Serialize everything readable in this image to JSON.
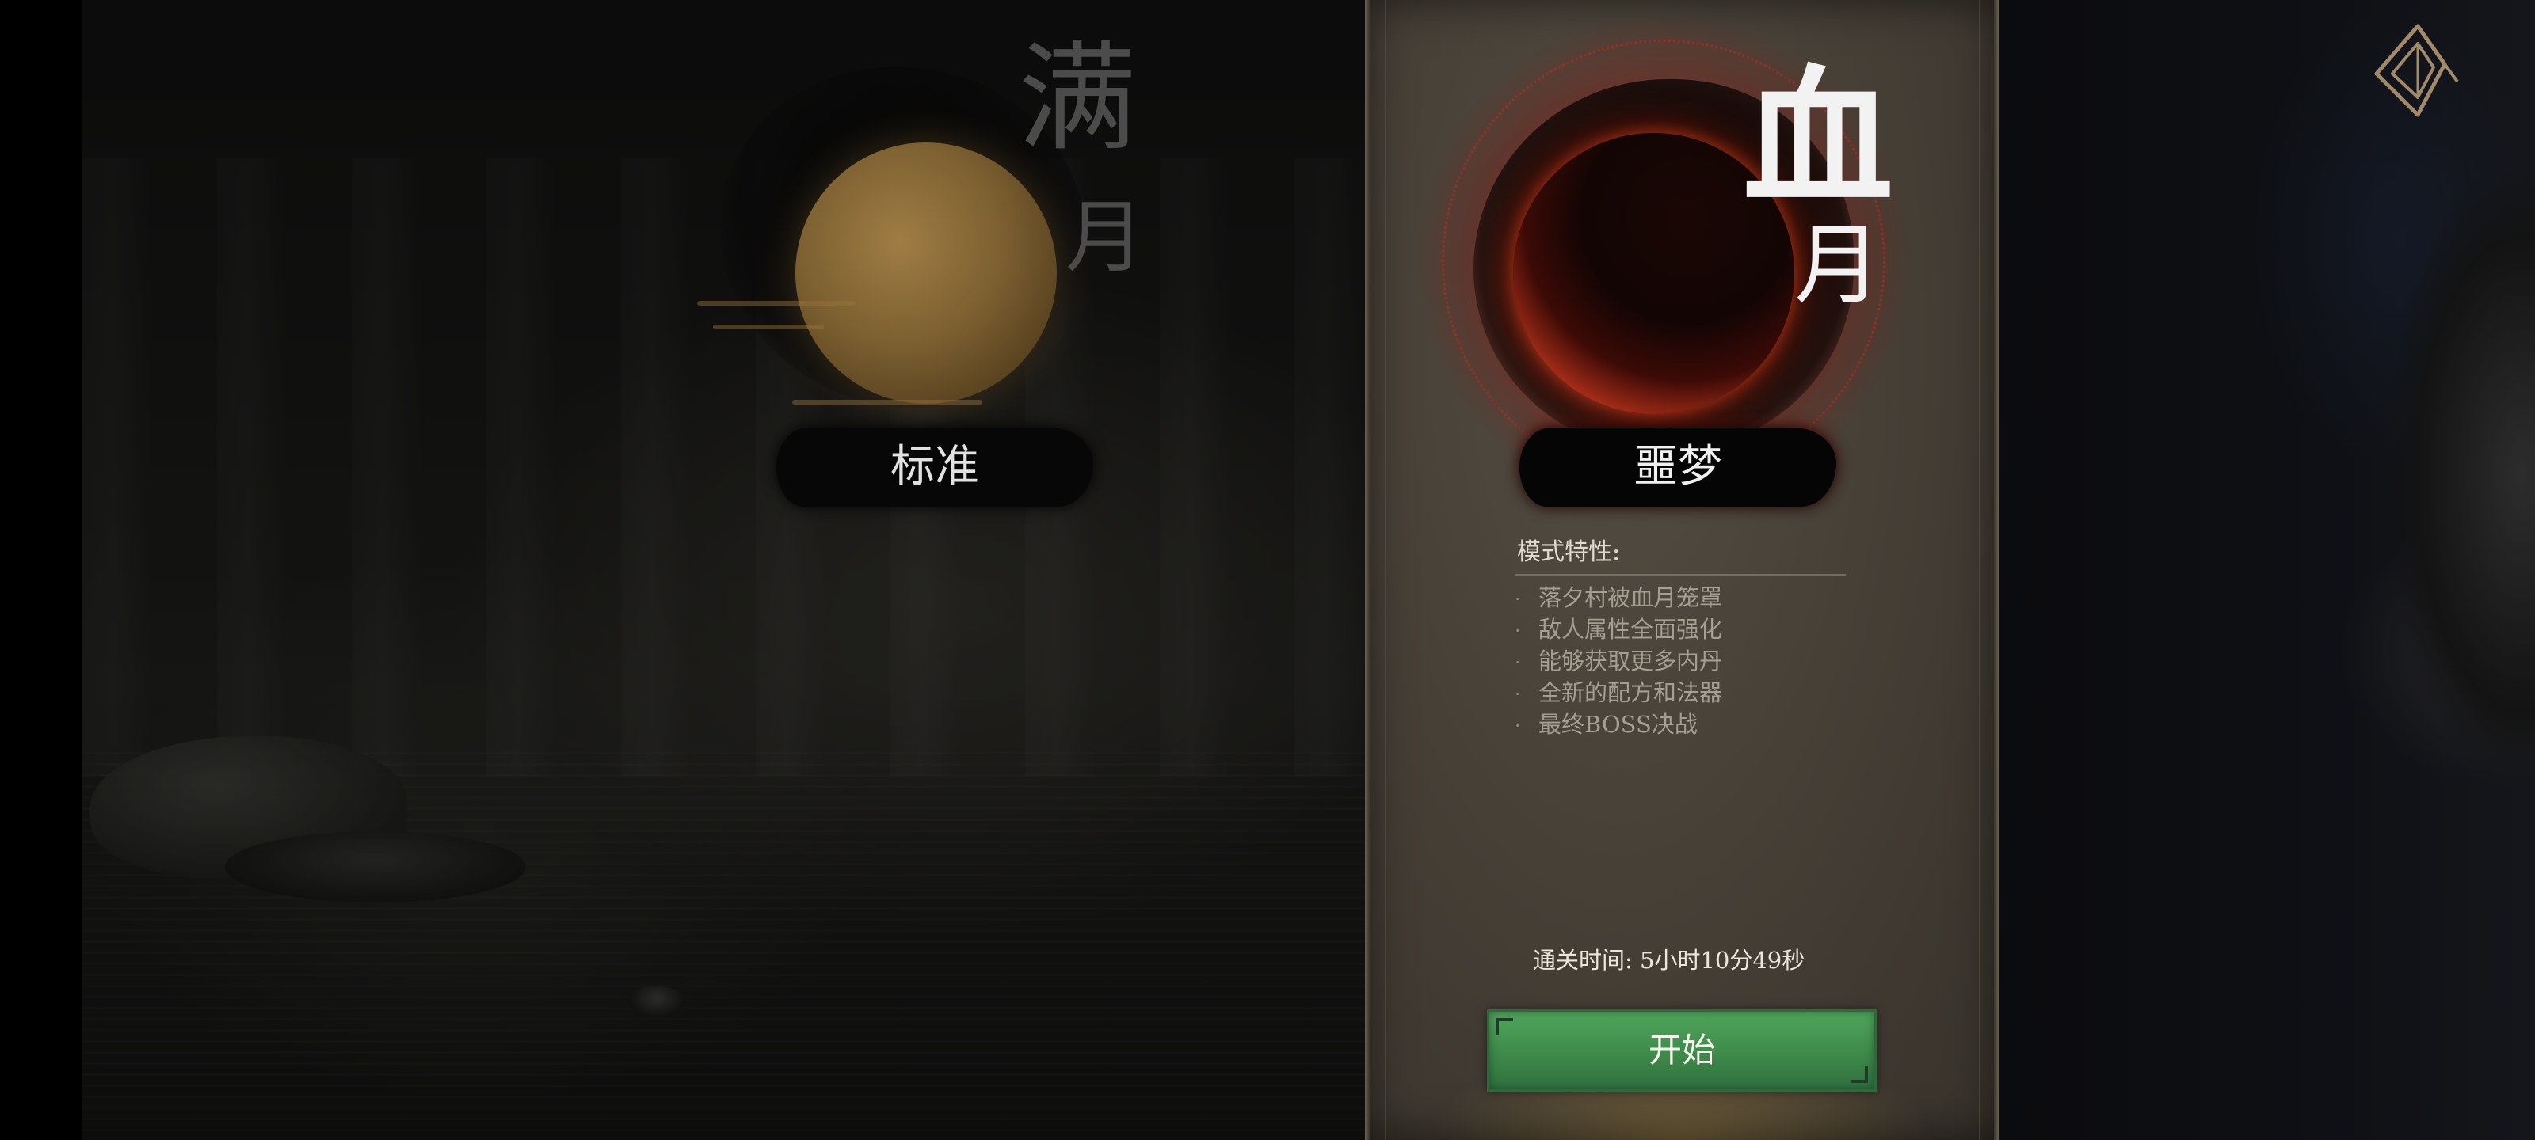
{
  "modes": {
    "standard": {
      "moon_title_1": "满",
      "moon_title_2": "月",
      "label": "标准"
    },
    "nightmare": {
      "moon_title_1": "血",
      "moon_title_2": "月",
      "label": "噩梦",
      "features_title": "模式特性:",
      "features": [
        "落夕村被血月笼罩",
        "敌人属性全面强化",
        "能够获取更多内丹",
        "全新的配方和法器",
        "最终BOSS决战"
      ],
      "bullet": "·",
      "clear_time_label": "通关时间:",
      "clear_time_value": "5小时10分49秒",
      "start_label": "开始"
    }
  },
  "icons": {
    "back": "back-diamond-icon"
  },
  "colors": {
    "panel_bg": "#4a443a",
    "start_button": "#46995a",
    "blood_moon": "#c2301a",
    "full_moon": "#9a7640"
  }
}
